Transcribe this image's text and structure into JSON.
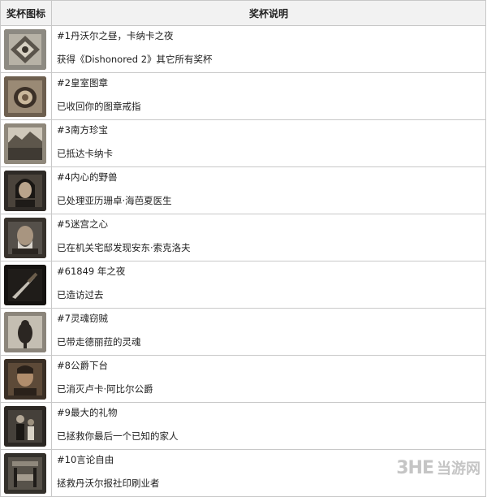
{
  "header": {
    "icon_col": "奖杯图标",
    "desc_col": "奖杯说明"
  },
  "trophies": [
    {
      "name": "#1丹沃尔之昼，卡纳卡之夜",
      "desc": "获得《Dishonored 2》其它所有奖杯",
      "icon": "emblem-icon"
    },
    {
      "name": "#2皇室图章",
      "desc": "已收回你的图章戒指",
      "icon": "signet-ring-icon"
    },
    {
      "name": "#3南方珍宝",
      "desc": "已抵达卡纳卡",
      "icon": "coastline-icon"
    },
    {
      "name": "#4内心的野兽",
      "desc": "已处理亚历珊卓·海芭夏医生",
      "icon": "portrait-woman-icon"
    },
    {
      "name": "#5迷宫之心",
      "desc": "已在机关宅邸发现安东·索克洛夫",
      "icon": "portrait-old-man-icon"
    },
    {
      "name": "#61849 年之夜",
      "desc": "已造访过去",
      "icon": "dagger-icon"
    },
    {
      "name": "#7灵魂窃贼",
      "desc": "已带走德丽菈的灵魂",
      "icon": "bird-icon"
    },
    {
      "name": "#8公爵下台",
      "desc": "已消灭卢卡·阿比尔公爵",
      "icon": "portrait-duke-icon"
    },
    {
      "name": "#9最大的礼物",
      "desc": "已拯救你最后一个已知的家人",
      "icon": "figures-icon"
    },
    {
      "name": "#10言论自由",
      "desc": "拯救丹沃尔报社印刷业者",
      "icon": "printing-press-icon"
    }
  ],
  "watermark": {
    "logo": "3HE",
    "text": "当游网"
  }
}
